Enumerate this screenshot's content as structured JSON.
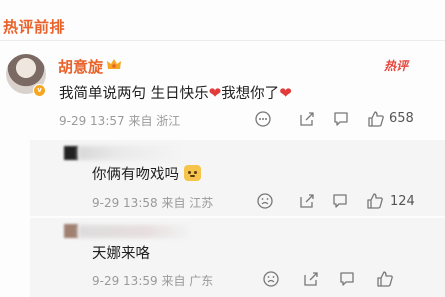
{
  "section": {
    "title": "热评前排"
  },
  "comment": {
    "username": "胡意旋",
    "hot_badge": "热评",
    "text_part1": "我简单说两句  生日快乐",
    "text_part2": "我想你了",
    "time": "9-29 13:57",
    "location": "来自 浙江",
    "likes": "658"
  },
  "replies": [
    {
      "text": "你俩有吻戏吗",
      "time": "9-29 13:58",
      "location": "来自 江苏",
      "likes": "124"
    },
    {
      "text": "天娜来咯",
      "time": "9-29 13:59",
      "location": "来自 广东",
      "likes": ""
    }
  ],
  "icons": [
    "heart-emoji",
    "grin-emoji",
    "more-icon",
    "share-icon",
    "comment-icon",
    "like-icon",
    "dislike-icon",
    "vip-crown-icon"
  ],
  "colors": {
    "accent": "#e8622a",
    "hot": "#e8453c",
    "heart": "#e23b3b",
    "meta": "#9a9a9a"
  }
}
